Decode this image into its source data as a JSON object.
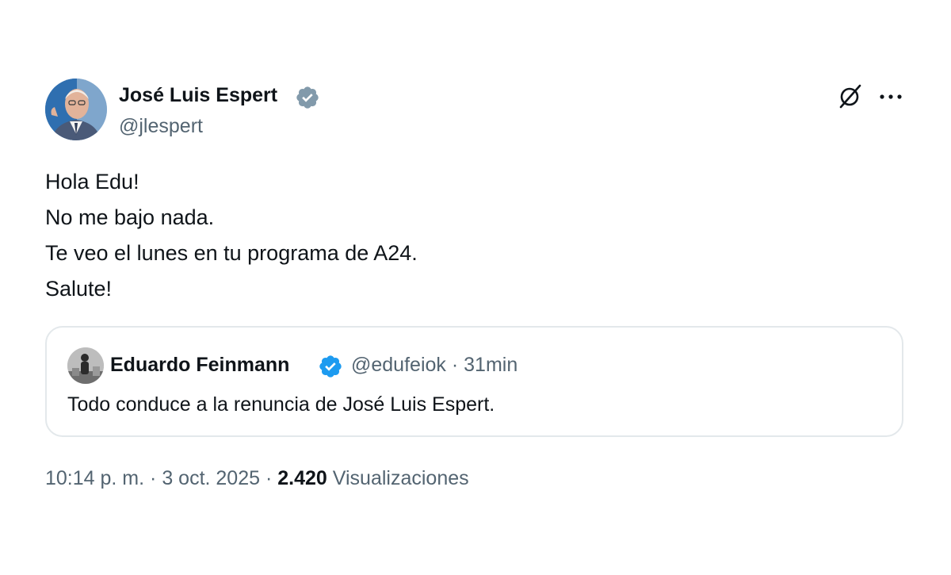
{
  "author": {
    "display_name": "José Luis Espert",
    "handle": "@jlespert",
    "verified_badge_color": "#829aab"
  },
  "icons": {
    "grok": "grok-icon",
    "more": "more-icon"
  },
  "tweet": {
    "lines": [
      "Hola Edu!",
      "No me bajo nada.",
      "Te veo el lunes en tu programa de A24.",
      "Salute!"
    ]
  },
  "quote": {
    "display_name": "Eduardo Feinmann",
    "handle": "@edufeiok",
    "separator": "·",
    "time": "31min",
    "verified_badge_color": "#1d9bf0",
    "text": "Todo conduce a la renuncia de José Luis Espert."
  },
  "footer": {
    "time": "10:14 p. m.",
    "separator": "·",
    "date": "3 oct. 2025",
    "views_count": "2.420",
    "views_label": "Visualizaciones"
  },
  "colors": {
    "text": "#0f1419",
    "secondary": "#536471",
    "border": "#e3e8eb"
  }
}
